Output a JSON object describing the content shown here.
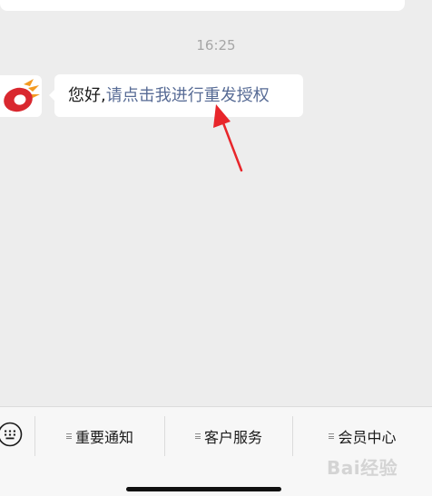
{
  "chat": {
    "timestamp": "16:25",
    "message": {
      "greeting": "您好,",
      "link": "请点击我进行重发授权"
    },
    "avatar_icon": "brand-logo-icon"
  },
  "menu": {
    "keyboard_icon": "keyboard-icon",
    "items": [
      {
        "label": "重要通知"
      },
      {
        "label": "客户服务"
      },
      {
        "label": "会员中心"
      }
    ]
  },
  "watermark": "Bai经验",
  "colors": {
    "background": "#ededed",
    "bubble": "#ffffff",
    "link": "#576b95",
    "timestamp": "#a6a6a6",
    "annotation_arrow": "#e8262b",
    "logo_red": "#d9282f",
    "logo_orange": "#f39a21"
  }
}
